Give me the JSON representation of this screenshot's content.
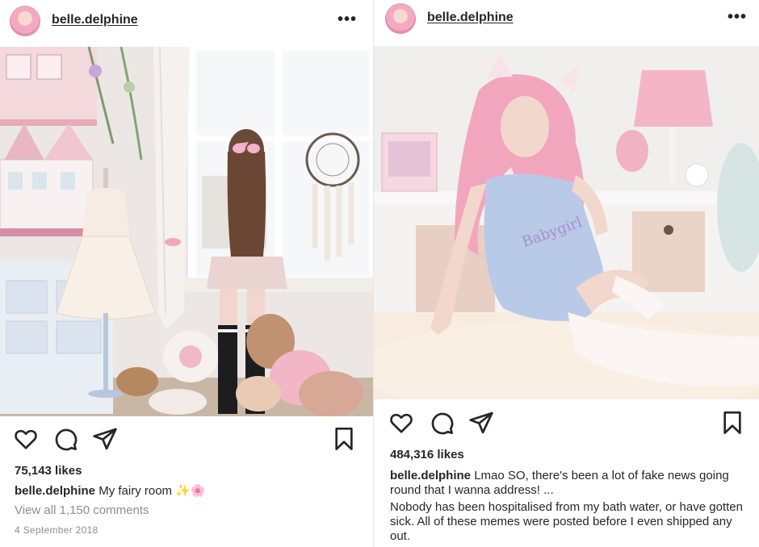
{
  "left_post": {
    "username": "belle.delphine",
    "more_label": "•••",
    "likes": "75,143 likes",
    "caption_user": "belle.delphine",
    "caption_text": "My fairy room ✨🌸",
    "comments_link": "View all 1,150 comments",
    "date": "4 September 2018",
    "icons": [
      "heart-icon",
      "comment-icon",
      "share-icon",
      "bookmark-icon"
    ]
  },
  "right_post": {
    "username": "belle.delphine",
    "more_label": "•••",
    "likes": "484,316 likes",
    "caption_user": "belle.delphine",
    "caption_text": "Lmao SO, there's been a lot of fake news going round that I wanna address! ...",
    "caption_more": "Nobody has been hospitalised from my bath water, or have gotten sick. All of these memes were posted before I even shipped any out.",
    "photo_text": "Babygirl",
    "icons": [
      "heart-icon",
      "comment-icon",
      "share-icon",
      "bookmark-icon"
    ]
  },
  "colors": {
    "text": "#262626",
    "muted": "#8e8e8e",
    "pink": "#f3a9c2"
  }
}
